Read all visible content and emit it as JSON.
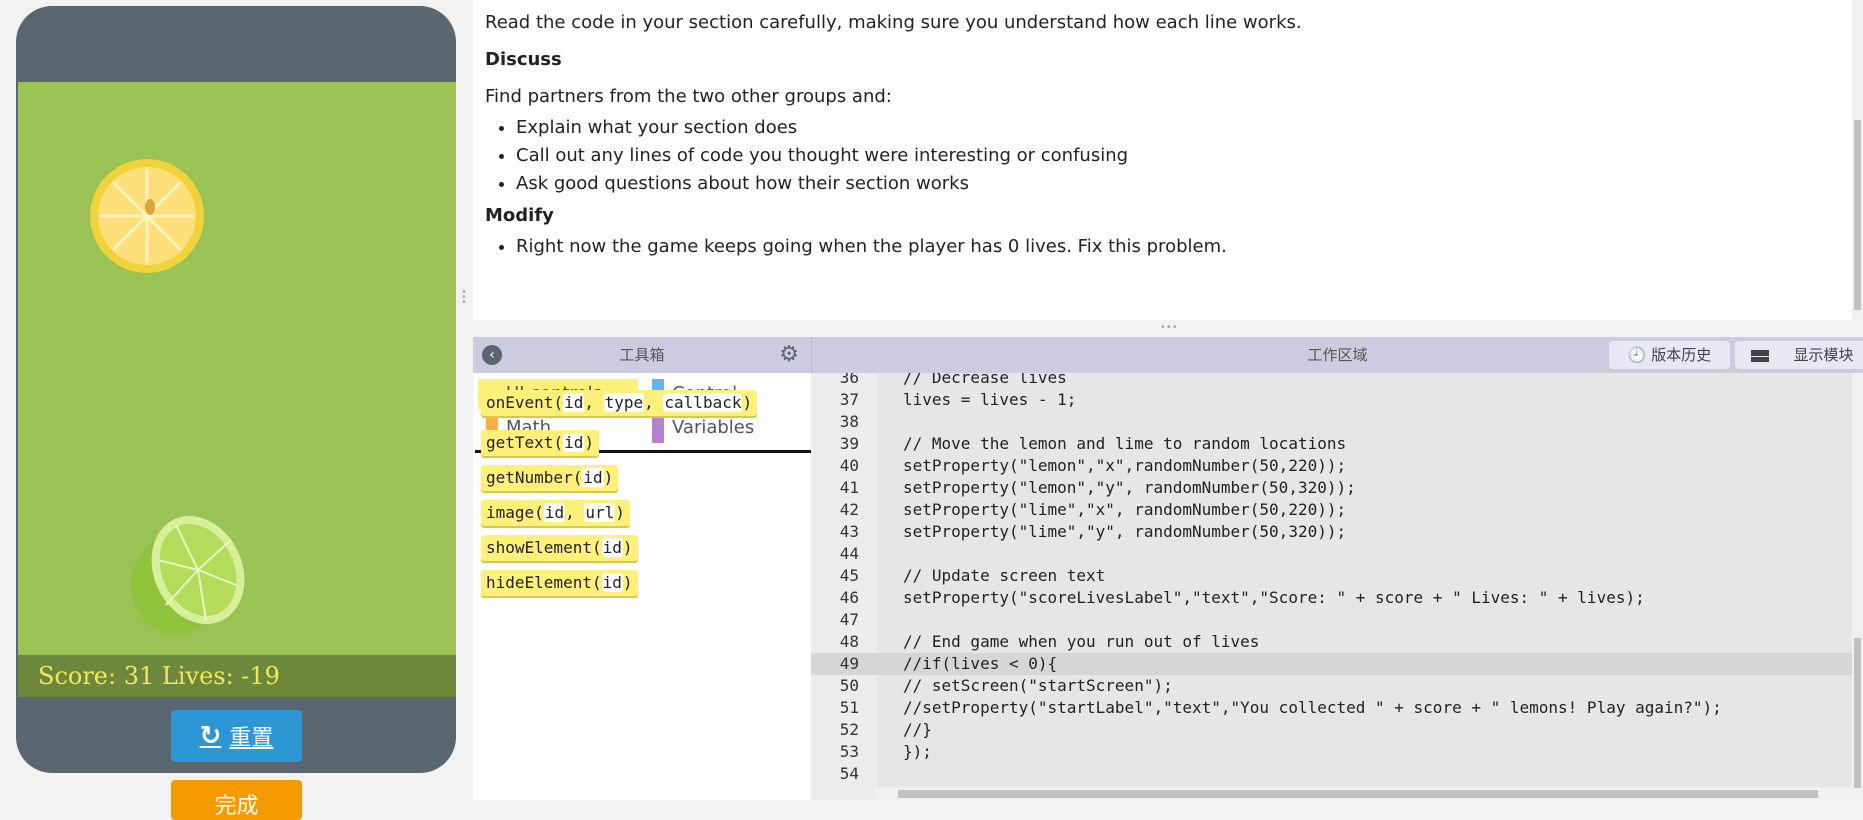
{
  "app": {
    "score_text": "Score: 31 Lives: -19",
    "reset_label": "重置",
    "finish_label": "完成"
  },
  "instructions": {
    "intro": "Read the code in your section carefully, making sure you understand how each line works.",
    "discuss_heading": "Discuss",
    "discuss_text": "Find partners from the two other groups and:",
    "discuss_items": [
      "Explain what your section does",
      "Call out any lines of code you thought were interesting or confusing",
      "Ask good questions about how their section works"
    ],
    "modify_heading": "Modify",
    "modify_items": [
      "Right now the game keeps going when the player has 0 lives. Fix this problem."
    ]
  },
  "toolbox": {
    "title": "工具箱",
    "categories": [
      {
        "label": "UI controls",
        "color": "#fff07a"
      },
      {
        "label": "Control",
        "color": "#64b5f6"
      },
      {
        "label": "Math",
        "color": "#ffad4a"
      },
      {
        "label": "Variables",
        "color": "#b77fd1"
      }
    ],
    "blocks": [
      {
        "name": "onEvent",
        "params": [
          "id",
          "type",
          "callback"
        ]
      },
      {
        "name": "getText",
        "params": [
          "id"
        ]
      },
      {
        "name": "getNumber",
        "params": [
          "id"
        ]
      },
      {
        "name": "image",
        "params": [
          "id",
          "url"
        ]
      },
      {
        "name": "showElement",
        "params": [
          "id"
        ]
      },
      {
        "name": "hideElement",
        "params": [
          "id"
        ]
      }
    ]
  },
  "workspace": {
    "title": "工作区域",
    "version_history_label": "版本历史",
    "show_blocks_label": "显示模块",
    "lines": [
      {
        "n": "36",
        "t": "// Decrease lives"
      },
      {
        "n": "37",
        "t": "lives = lives - 1;"
      },
      {
        "n": "38",
        "t": ""
      },
      {
        "n": "39",
        "t": "// Move the lemon and lime to random locations"
      },
      {
        "n": "40",
        "t": "setProperty(\"lemon\",\"x\",randomNumber(50,220));"
      },
      {
        "n": "41",
        "t": "setProperty(\"lemon\",\"y\", randomNumber(50,320));"
      },
      {
        "n": "42",
        "t": "setProperty(\"lime\",\"x\", randomNumber(50,220));"
      },
      {
        "n": "43",
        "t": "setProperty(\"lime\",\"y\", randomNumber(50,320));"
      },
      {
        "n": "44",
        "t": ""
      },
      {
        "n": "45",
        "t": "// Update screen text"
      },
      {
        "n": "46",
        "t": "setProperty(\"scoreLivesLabel\",\"text\",\"Score: \" + score + \" Lives: \" + lives);"
      },
      {
        "n": "47",
        "t": ""
      },
      {
        "n": "48",
        "t": "// End game when you run out of lives"
      },
      {
        "n": "49",
        "t": "//if(lives < 0){"
      },
      {
        "n": "50",
        "t": "// setScreen(\"startScreen\");"
      },
      {
        "n": "51",
        "t": "//setProperty(\"startLabel\",\"text\",\"You collected \" + score + \" lemons! Play again?\");"
      },
      {
        "n": "52",
        "t": "//}"
      },
      {
        "n": "53",
        "t": "});"
      },
      {
        "n": "54",
        "t": ""
      }
    ],
    "active_line": "49"
  }
}
